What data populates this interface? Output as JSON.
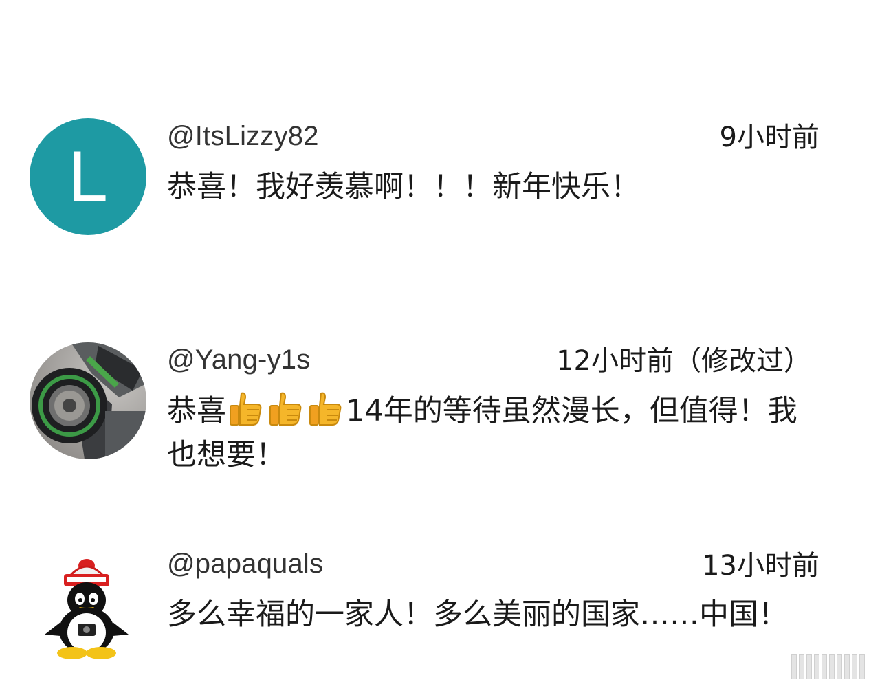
{
  "comments": [
    {
      "author": "@ItsLizzy82",
      "time": "9小时前",
      "avatar_letter": "L",
      "avatar_color": "#1e9aa3",
      "text": "恭喜！我好羡慕啊！！！新年快乐！"
    },
    {
      "author": "@Yang-y1s",
      "time": "12小时前（修改过）",
      "avatar_icon": "motorcycle-wheel-photo",
      "text_prefix": "恭喜",
      "thumbs_count": 3,
      "text_suffix": "14年的等待虽然漫长，但值得！我也想要！"
    },
    {
      "author": "@papaquals",
      "time": "13小时前",
      "avatar_icon": "penguin-with-hat",
      "text": "多么幸福的一家人！多么美丽的国家……中国！"
    }
  ]
}
